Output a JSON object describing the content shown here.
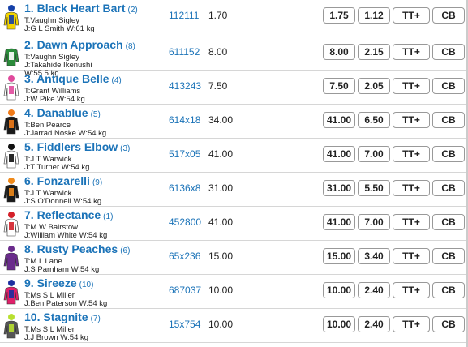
{
  "runners": [
    {
      "number": "1",
      "name": "Black Heart Bart",
      "draw": "(2)",
      "trainer": "T:Vaughn Sigley",
      "jockey": "J:G L Smith",
      "weight": "W:61 kg",
      "form": "112111",
      "price": "1.70",
      "win": "1.75",
      "place": "1.12",
      "tt": "TT+",
      "cb": "CB",
      "silk_colors": [
        "#1540a8",
        "#f2d400",
        "#1540a8"
      ]
    },
    {
      "number": "2",
      "name": "Dawn Approach",
      "draw": "(8)",
      "trainer": "T:Vaughn Sigley",
      "jockey": "J:Takahide Ikenushi",
      "weight": "W:55.5 kg",
      "form": "611152",
      "price": "8.00",
      "win": "8.00",
      "place": "2.15",
      "tt": "TT+",
      "cb": "CB",
      "silk_colors": [
        "#ffffff",
        "#2a8c3a",
        "#ffffff"
      ]
    },
    {
      "number": "3",
      "name": "Antique Belle",
      "draw": "(4)",
      "trainer": "T:Grant Williams",
      "jockey": "J:W Pike",
      "weight": "W:54 kg",
      "form": "413243",
      "price": "7.50",
      "win": "7.50",
      "place": "2.05",
      "tt": "TT+",
      "cb": "CB",
      "silk_colors": [
        "#e04a9c",
        "#ffffff",
        "#e04a9c"
      ]
    },
    {
      "number": "4",
      "name": "Danablue",
      "draw": "(5)",
      "trainer": "T:Ben Pearce",
      "jockey": "J:Jarrad Noske",
      "weight": "W:54 kg",
      "form": "614x18",
      "price": "34.00",
      "win": "41.00",
      "place": "6.50",
      "tt": "TT+",
      "cb": "CB",
      "silk_colors": [
        "#f07b1a",
        "#1a1a1a",
        "#f07b1a"
      ]
    },
    {
      "number": "5",
      "name": "Fiddlers Elbow",
      "draw": "(3)",
      "trainer": "T:J T Warwick",
      "jockey": "J:T Turner",
      "weight": "W:54 kg",
      "form": "517x05",
      "price": "41.00",
      "win": "41.00",
      "place": "7.00",
      "tt": "TT+",
      "cb": "CB",
      "silk_colors": [
        "#111111",
        "#ffffff",
        "#111111"
      ]
    },
    {
      "number": "6",
      "name": "Fonzarelli",
      "draw": "(9)",
      "trainer": "T:J T Warwick",
      "jockey": "J:S O'Donnell",
      "weight": "W:54 kg",
      "form": "6136x8",
      "price": "31.00",
      "win": "31.00",
      "place": "5.50",
      "tt": "TT+",
      "cb": "CB",
      "silk_colors": [
        "#f08a1a",
        "#1a1a1a",
        "#f08a1a"
      ]
    },
    {
      "number": "7",
      "name": "Reflectance",
      "draw": "(1)",
      "trainer": "T:M W Bairstow",
      "jockey": "J:William White",
      "weight": "W:54 kg",
      "form": "452800",
      "price": "41.00",
      "win": "41.00",
      "place": "7.00",
      "tt": "TT+",
      "cb": "CB",
      "silk_colors": [
        "#d4202a",
        "#ffffff",
        "#d4202a"
      ]
    },
    {
      "number": "8",
      "name": "Rusty Peaches",
      "draw": "(6)",
      "trainer": "T:M L Lane",
      "jockey": "J:S Parnham",
      "weight": "W:54 kg",
      "form": "65x236",
      "price": "15.00",
      "win": "15.00",
      "place": "3.40",
      "tt": "TT+",
      "cb": "CB",
      "silk_colors": [
        "#6a2b8c",
        "#6a2b8c",
        "#6a2b8c"
      ]
    },
    {
      "number": "9",
      "name": "Sireeze",
      "draw": "(10)",
      "trainer": "T:Ms S L Miller",
      "jockey": "J:Ben Paterson",
      "weight": "W:54 kg",
      "form": "687037",
      "price": "10.00",
      "win": "10.00",
      "place": "2.40",
      "tt": "TT+",
      "cb": "CB",
      "silk_colors": [
        "#1c2fa0",
        "#e0206a",
        "#1c2fa0"
      ]
    },
    {
      "number": "10",
      "name": "Stagnite",
      "draw": "(7)",
      "trainer": "T:Ms S L Miller",
      "jockey": "J:J Brown",
      "weight": "W:54 kg",
      "form": "15x754",
      "price": "10.00",
      "win": "10.00",
      "place": "2.40",
      "tt": "TT+",
      "cb": "CB",
      "silk_colors": [
        "#b8e030",
        "#555555",
        "#b8e030"
      ]
    }
  ]
}
